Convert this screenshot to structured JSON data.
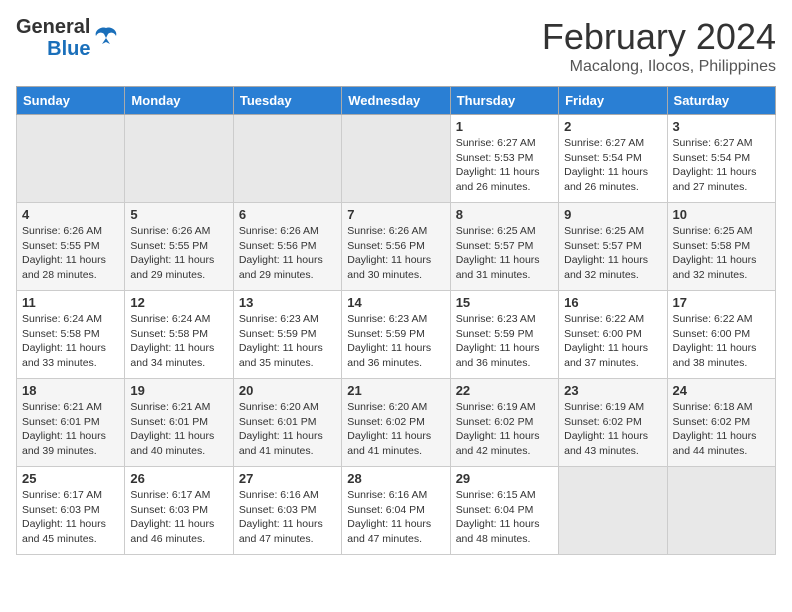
{
  "header": {
    "logo_general": "General",
    "logo_blue": "Blue",
    "month": "February 2024",
    "location": "Macalong, Ilocos, Philippines"
  },
  "days_of_week": [
    "Sunday",
    "Monday",
    "Tuesday",
    "Wednesday",
    "Thursday",
    "Friday",
    "Saturday"
  ],
  "weeks": [
    [
      {
        "day": "",
        "empty": true
      },
      {
        "day": "",
        "empty": true
      },
      {
        "day": "",
        "empty": true
      },
      {
        "day": "",
        "empty": true
      },
      {
        "day": "1",
        "sunrise": "6:27 AM",
        "sunset": "5:53 PM",
        "daylight": "11 hours and 26 minutes."
      },
      {
        "day": "2",
        "sunrise": "6:27 AM",
        "sunset": "5:54 PM",
        "daylight": "11 hours and 26 minutes."
      },
      {
        "day": "3",
        "sunrise": "6:27 AM",
        "sunset": "5:54 PM",
        "daylight": "11 hours and 27 minutes."
      }
    ],
    [
      {
        "day": "4",
        "sunrise": "6:26 AM",
        "sunset": "5:55 PM",
        "daylight": "11 hours and 28 minutes."
      },
      {
        "day": "5",
        "sunrise": "6:26 AM",
        "sunset": "5:55 PM",
        "daylight": "11 hours and 29 minutes."
      },
      {
        "day": "6",
        "sunrise": "6:26 AM",
        "sunset": "5:56 PM",
        "daylight": "11 hours and 29 minutes."
      },
      {
        "day": "7",
        "sunrise": "6:26 AM",
        "sunset": "5:56 PM",
        "daylight": "11 hours and 30 minutes."
      },
      {
        "day": "8",
        "sunrise": "6:25 AM",
        "sunset": "5:57 PM",
        "daylight": "11 hours and 31 minutes."
      },
      {
        "day": "9",
        "sunrise": "6:25 AM",
        "sunset": "5:57 PM",
        "daylight": "11 hours and 32 minutes."
      },
      {
        "day": "10",
        "sunrise": "6:25 AM",
        "sunset": "5:58 PM",
        "daylight": "11 hours and 32 minutes."
      }
    ],
    [
      {
        "day": "11",
        "sunrise": "6:24 AM",
        "sunset": "5:58 PM",
        "daylight": "11 hours and 33 minutes."
      },
      {
        "day": "12",
        "sunrise": "6:24 AM",
        "sunset": "5:58 PM",
        "daylight": "11 hours and 34 minutes."
      },
      {
        "day": "13",
        "sunrise": "6:23 AM",
        "sunset": "5:59 PM",
        "daylight": "11 hours and 35 minutes."
      },
      {
        "day": "14",
        "sunrise": "6:23 AM",
        "sunset": "5:59 PM",
        "daylight": "11 hours and 36 minutes."
      },
      {
        "day": "15",
        "sunrise": "6:23 AM",
        "sunset": "5:59 PM",
        "daylight": "11 hours and 36 minutes."
      },
      {
        "day": "16",
        "sunrise": "6:22 AM",
        "sunset": "6:00 PM",
        "daylight": "11 hours and 37 minutes."
      },
      {
        "day": "17",
        "sunrise": "6:22 AM",
        "sunset": "6:00 PM",
        "daylight": "11 hours and 38 minutes."
      }
    ],
    [
      {
        "day": "18",
        "sunrise": "6:21 AM",
        "sunset": "6:01 PM",
        "daylight": "11 hours and 39 minutes."
      },
      {
        "day": "19",
        "sunrise": "6:21 AM",
        "sunset": "6:01 PM",
        "daylight": "11 hours and 40 minutes."
      },
      {
        "day": "20",
        "sunrise": "6:20 AM",
        "sunset": "6:01 PM",
        "daylight": "11 hours and 41 minutes."
      },
      {
        "day": "21",
        "sunrise": "6:20 AM",
        "sunset": "6:02 PM",
        "daylight": "11 hours and 41 minutes."
      },
      {
        "day": "22",
        "sunrise": "6:19 AM",
        "sunset": "6:02 PM",
        "daylight": "11 hours and 42 minutes."
      },
      {
        "day": "23",
        "sunrise": "6:19 AM",
        "sunset": "6:02 PM",
        "daylight": "11 hours and 43 minutes."
      },
      {
        "day": "24",
        "sunrise": "6:18 AM",
        "sunset": "6:02 PM",
        "daylight": "11 hours and 44 minutes."
      }
    ],
    [
      {
        "day": "25",
        "sunrise": "6:17 AM",
        "sunset": "6:03 PM",
        "daylight": "11 hours and 45 minutes."
      },
      {
        "day": "26",
        "sunrise": "6:17 AM",
        "sunset": "6:03 PM",
        "daylight": "11 hours and 46 minutes."
      },
      {
        "day": "27",
        "sunrise": "6:16 AM",
        "sunset": "6:03 PM",
        "daylight": "11 hours and 47 minutes."
      },
      {
        "day": "28",
        "sunrise": "6:16 AM",
        "sunset": "6:04 PM",
        "daylight": "11 hours and 47 minutes."
      },
      {
        "day": "29",
        "sunrise": "6:15 AM",
        "sunset": "6:04 PM",
        "daylight": "11 hours and 48 minutes."
      },
      {
        "day": "",
        "empty": true
      },
      {
        "day": "",
        "empty": true
      }
    ]
  ]
}
